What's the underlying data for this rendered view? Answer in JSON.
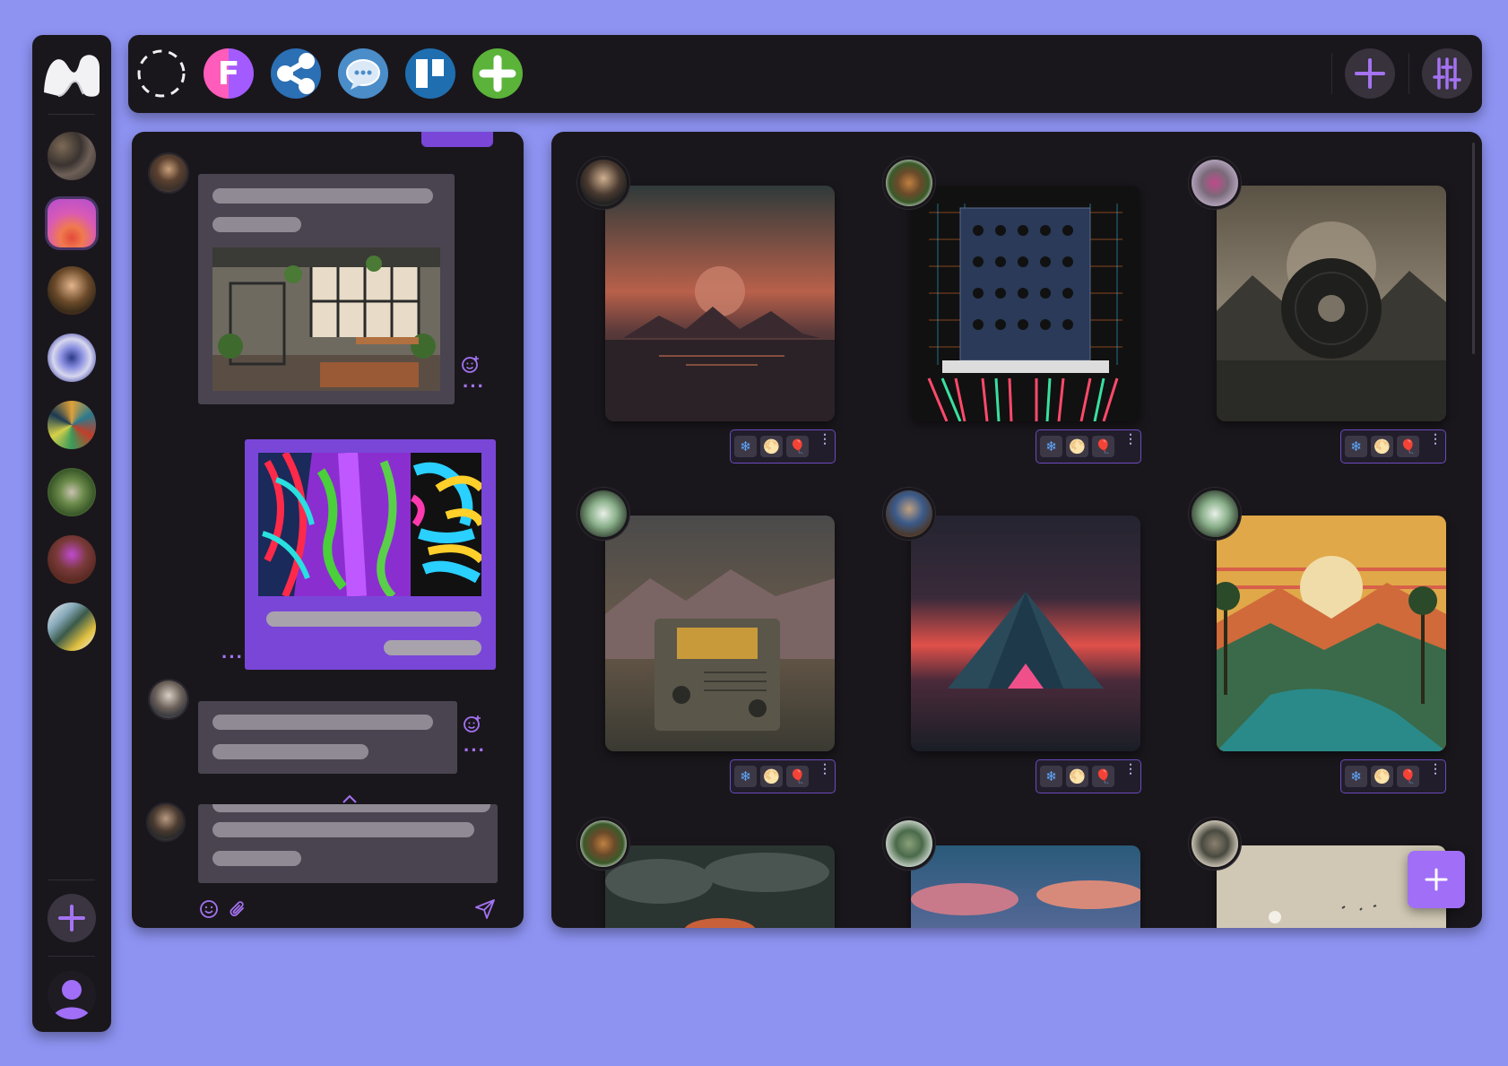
{
  "app": {
    "logo": "waves-logo-icon"
  },
  "workspaces": [
    {
      "name": "workspace-1",
      "active": false
    },
    {
      "name": "workspace-2",
      "active": true
    },
    {
      "name": "workspace-3",
      "active": false
    },
    {
      "name": "workspace-4",
      "active": false
    },
    {
      "name": "workspace-5",
      "active": false
    },
    {
      "name": "workspace-6",
      "active": false
    },
    {
      "name": "workspace-7",
      "active": false
    },
    {
      "name": "workspace-8",
      "active": false
    }
  ],
  "topbar": {
    "apps": [
      "dashed-circle-icon",
      "figma-icon",
      "share-icon",
      "chat-bubble-icon",
      "trello-icon",
      "add-app-icon"
    ],
    "figma_letter": "F",
    "actions": [
      "add-icon",
      "sliders-icon"
    ]
  },
  "chat": {
    "messages": [
      {
        "author": "user-1",
        "type": "text+image",
        "mine": false
      },
      {
        "author": "me",
        "type": "image+text",
        "mine": true
      },
      {
        "author": "user-2",
        "type": "text",
        "mine": false
      },
      {
        "author": "user-3",
        "type": "text",
        "mine": false
      }
    ],
    "composer": {
      "icons": [
        "emoji-icon",
        "attach-icon",
        "send-icon"
      ]
    }
  },
  "gallery": {
    "reactions": [
      "❄",
      "🌕",
      "🎈"
    ],
    "more": "⋮",
    "fab_icon": "add-icon",
    "items": [
      {
        "title": "sunset-mountains"
      },
      {
        "title": "modular-synth"
      },
      {
        "title": "vinyl-landscape"
      },
      {
        "title": "retro-radio"
      },
      {
        "title": "neon-pyramid"
      },
      {
        "title": "tropical-sunset"
      },
      {
        "title": "cloudy-sunset"
      },
      {
        "title": "pink-clouds"
      },
      {
        "title": "beige-minimal"
      }
    ]
  },
  "colors": {
    "background": "#8e93f2",
    "panel": "#1a171c",
    "accent": "#7a46d8",
    "accent_light": "#a06ef7",
    "bubble": "#4a4450"
  }
}
